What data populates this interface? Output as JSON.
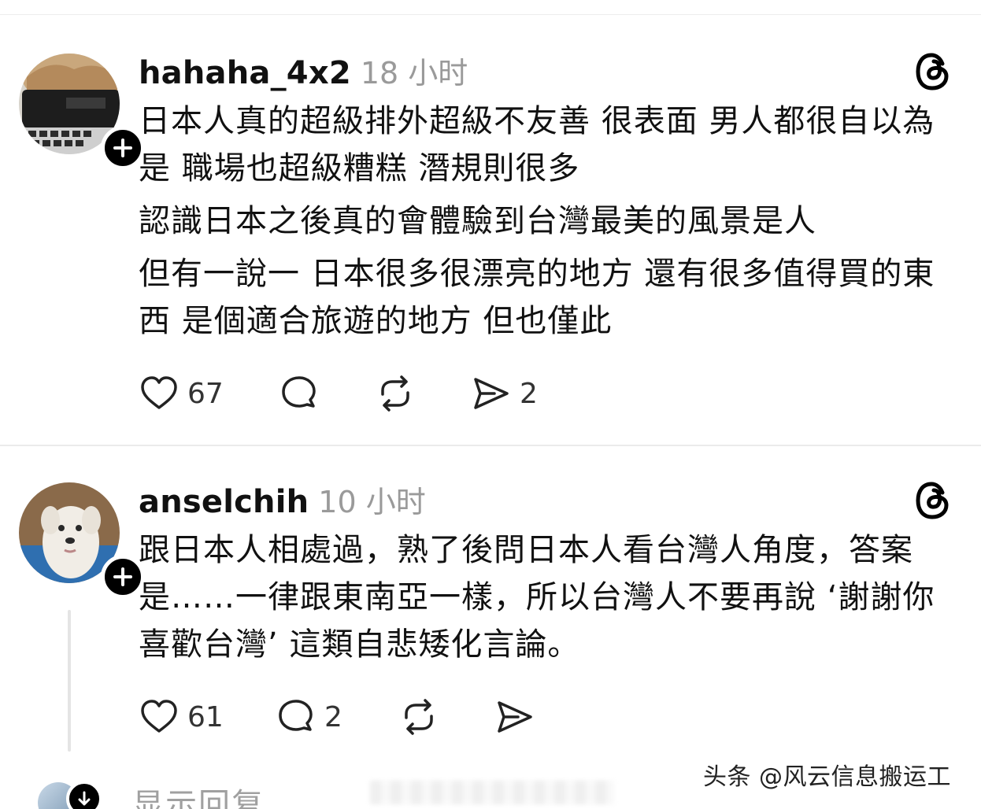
{
  "posts": [
    {
      "username": "hahaha_4x2",
      "timestamp": "18 小时",
      "lines": [
        "日本人真的超級排外超級不友善 很表面 男人都很自以為是 職場也超級糟糕 潛規則很多",
        "認識日本之後真的會體驗到台灣最美的風景是人",
        "但有一說一 日本很多很漂亮的地方 還有很多值得買的東西 是個適合旅遊的地方 但也僅此"
      ],
      "actions": {
        "likes": "67",
        "replies": "",
        "reposts": "",
        "shares": "2"
      }
    },
    {
      "username": "anselchih",
      "timestamp": "10 小时",
      "lines": [
        "跟日本人相處過，熟了後問日本人看台灣人角度，答案是……一律跟東南亞一樣，所以台灣人不要再說 ‘謝謝你喜歡台灣’ 這類自悲矮化言論。"
      ],
      "actions": {
        "likes": "61",
        "replies": "2",
        "reposts": "",
        "shares": ""
      }
    }
  ],
  "show_replies": {
    "label": "显示回复"
  },
  "watermark": "头条 @风云信息搬运工",
  "icons": {
    "follow": "plus-icon",
    "logo": "threads-logo-icon",
    "like": "heart-icon",
    "reply": "comment-bubble-icon",
    "repost": "repost-icon",
    "share": "send-icon",
    "expand": "arrow-down-icon"
  },
  "colors": {
    "text": "#111111",
    "muted": "#9a9a9a",
    "badge": "#000000",
    "divider": "#ebebeb"
  }
}
